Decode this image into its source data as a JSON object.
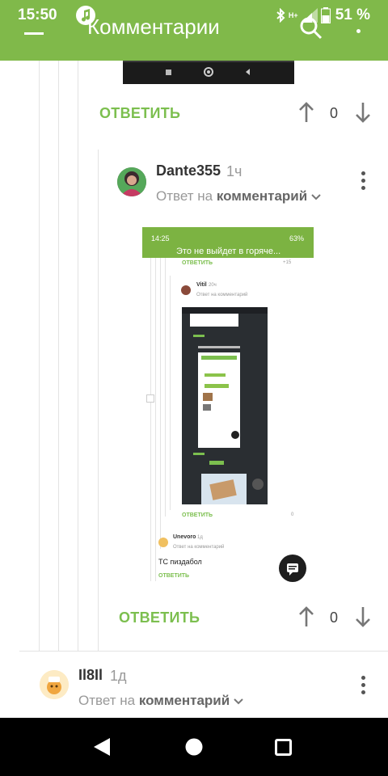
{
  "status_bar": {
    "time": "15:50",
    "network": "H+",
    "battery": "51 %"
  },
  "app_bar": {
    "title": "Комментарии"
  },
  "comments": [
    {
      "reply_label": "ОТВЕТИТЬ",
      "rating": "0"
    },
    {
      "author": "Dante355",
      "age": "1ч",
      "reply_to_prefix": "Ответ на",
      "reply_to_link": "комментарий",
      "reply_label": "ОТВЕТИТЬ",
      "rating": "0"
    },
    {
      "author": "Il8Il",
      "age": "1д",
      "reply_to_prefix": "Ответ на",
      "reply_to_link": "комментарий"
    }
  ],
  "embedded_screenshot": {
    "time": "14:25",
    "battery": "63%",
    "title": "Это не выйдет в горяче...",
    "reply_top": "ОТВЕТИТЬ",
    "rating_top": "+15",
    "commenter1": "Vitil",
    "commenter1_age": "20ч",
    "reply_to": "Ответ на комментарий",
    "reply_mid": "ОТВЕТИТЬ",
    "rating_mid": "0",
    "commenter2": "Unevoro",
    "commenter2_age": "1д",
    "comment_text": "ТС пиздабол",
    "reply_bottom": "ОТВЕТИТЬ"
  },
  "colors": {
    "accent": "#80b94a",
    "reply_green": "#7cbf4f",
    "navbar": "#000000"
  }
}
